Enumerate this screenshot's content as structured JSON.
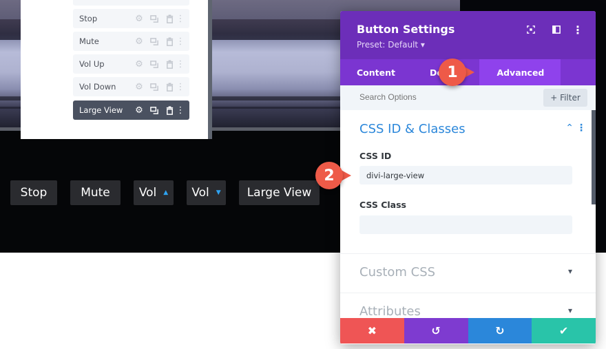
{
  "layers": {
    "items": [
      {
        "label": "Stop",
        "active": false
      },
      {
        "label": "Mute",
        "active": false
      },
      {
        "label": "Vol Up",
        "active": false
      },
      {
        "label": "Vol Down",
        "active": false
      },
      {
        "label": "Large View",
        "active": true
      }
    ],
    "icons": [
      "gear-icon",
      "duplicate-icon",
      "trash-icon",
      "more-vertical-icon"
    ]
  },
  "frontend_buttons": [
    {
      "label": "Stop"
    },
    {
      "label": "Mute"
    },
    {
      "label": "Vol",
      "arrow": "▲"
    },
    {
      "label": "Vol",
      "arrow": "▼"
    },
    {
      "label": "Large View"
    }
  ],
  "callouts": [
    "1",
    "2"
  ],
  "modal": {
    "title": "Button Settings",
    "preset": "Preset: Default ▾",
    "header_icons": [
      "fullscreen-icon",
      "split-view-icon",
      "more-vertical-icon"
    ],
    "tabs": [
      {
        "label": "Content",
        "active": false
      },
      {
        "label": "Design",
        "active": false
      },
      {
        "label": "Advanced",
        "active": true
      }
    ],
    "search_placeholder": "Search Options",
    "filter_label": "+ Filter",
    "sections": {
      "css_id_classes": {
        "title": "CSS ID & Classes",
        "css_id_label": "CSS ID",
        "css_id_value": "divi-large-view",
        "css_class_label": "CSS Class",
        "css_class_value": ""
      },
      "custom_css": {
        "title": "Custom CSS"
      },
      "attributes": {
        "title": "Attributes"
      }
    },
    "footer": [
      {
        "name": "discard",
        "icon": "✖",
        "color": "#ef5555"
      },
      {
        "name": "undo",
        "icon": "↺",
        "color": "#7e3bd0"
      },
      {
        "name": "redo",
        "icon": "↻",
        "color": "#2b87da"
      },
      {
        "name": "save",
        "icon": "✔",
        "color": "#29c4a9"
      }
    ]
  },
  "colors": {
    "purple_header": "#6c2eb9",
    "purple_tabs": "#7b35d1",
    "accent_blue": "#2b87da",
    "callout_red": "#ee5a48"
  }
}
